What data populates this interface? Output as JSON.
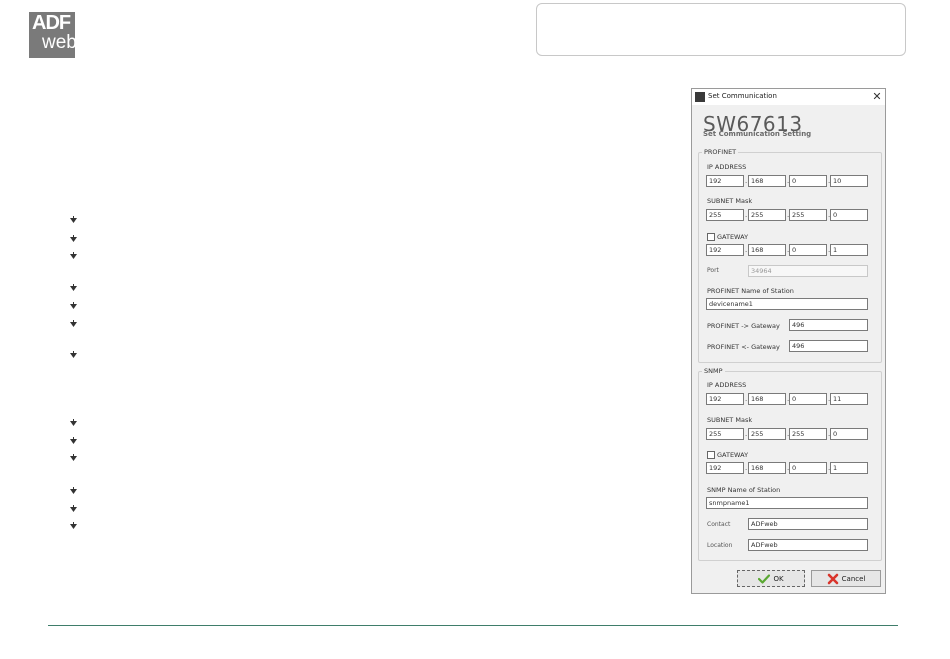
{
  "logo": {
    "line1": "ADF",
    "line2": "web"
  },
  "dialog": {
    "window_title": "Set Communication",
    "close_glyph": "✕",
    "header": "SW67613",
    "subheader": "Set Communication Setting",
    "profinet": {
      "group_label": "PROFINET",
      "ip_label": "IP ADDRESS",
      "ip": [
        "192",
        "168",
        "0",
        "10"
      ],
      "subnet_label": "SUBNET Mask",
      "subnet": [
        "255",
        "255",
        "255",
        "0"
      ],
      "gateway_label": "GATEWAY",
      "gateway_checked": false,
      "gateway": [
        "192",
        "168",
        "0",
        "1"
      ],
      "port_label": "Port",
      "port_value": "34964",
      "name_label": "PROFINET Name of Station",
      "name_value": "devicename1",
      "to_gateway_label": "PROFINET -> Gateway",
      "to_gateway_value": "496",
      "from_gateway_label": "PROFINET <- Gateway",
      "from_gateway_value": "496"
    },
    "snmp": {
      "group_label": "SNMP",
      "ip_label": "IP ADDRESS",
      "ip": [
        "192",
        "168",
        "0",
        "11"
      ],
      "subnet_label": "SUBNET Mask",
      "subnet": [
        "255",
        "255",
        "255",
        "0"
      ],
      "gateway_label": "GATEWAY",
      "gateway_checked": false,
      "gateway": [
        "192",
        "168",
        "0",
        "1"
      ],
      "name_label": "SNMP Name of Station",
      "name_value": "snmpname1",
      "contact_label": "Contact",
      "contact_value": "ADFweb",
      "location_label": "Location",
      "location_value": "ADFweb"
    },
    "ok_label": "OK",
    "cancel_label": "Cancel"
  },
  "colors": {
    "footer_line": "#3f7d6a",
    "logo_bg": "#7a7a7a"
  }
}
